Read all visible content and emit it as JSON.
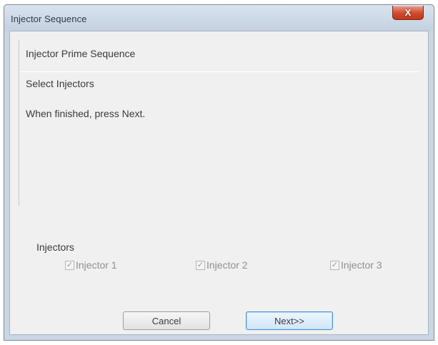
{
  "window": {
    "title": "Injector Sequence",
    "close_label": "X"
  },
  "content": {
    "sequence_title": "Injector Prime Sequence",
    "step_label": "Select Injectors",
    "instruction": "When finished, press Next."
  },
  "injectors": {
    "group_label": "Injectors",
    "items": [
      {
        "label": "Injector 1",
        "checked": true
      },
      {
        "label": "Injector 2",
        "checked": true
      },
      {
        "label": "Injector 3",
        "checked": true
      }
    ]
  },
  "buttons": {
    "cancel": "Cancel",
    "next": "Next>>"
  },
  "icons": {
    "check": "✓"
  }
}
